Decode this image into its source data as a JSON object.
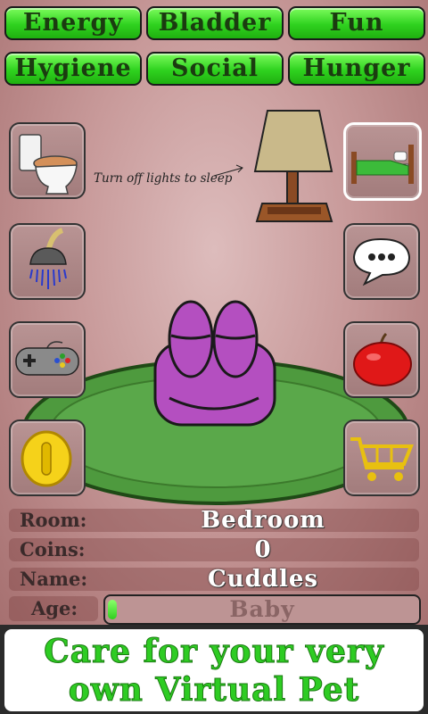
{
  "stats": [
    {
      "label": "Energy"
    },
    {
      "label": "Bladder"
    },
    {
      "label": "Fun"
    },
    {
      "label": "Hygiene"
    },
    {
      "label": "Social"
    },
    {
      "label": "Hunger"
    }
  ],
  "hint_text": "Turn off lights to sleep",
  "side_buttons": {
    "left": [
      "toilet-icon",
      "shower-icon",
      "gamepad-icon",
      "coin-icon"
    ],
    "right": [
      "bed-icon",
      "speech-bubble-icon",
      "apple-icon",
      "shopping-cart-icon"
    ],
    "active": "bed-icon"
  },
  "info": {
    "room_label": "Room:",
    "room_value": "Bedroom",
    "coins_label": "Coins:",
    "coins_value": "0",
    "name_label": "Name:",
    "name_value": "Cuddles",
    "age_label": "Age:",
    "age_value": "Baby",
    "age_progress": 0.03
  },
  "banner": {
    "line1": "Care for your very",
    "line2": "own Virtual Pet"
  },
  "colors": {
    "accent_green": "#2ecc23",
    "pet_purple": "#b44fc0",
    "rug_green": "#4e9a3e",
    "room_pink": "#c89a9a"
  }
}
